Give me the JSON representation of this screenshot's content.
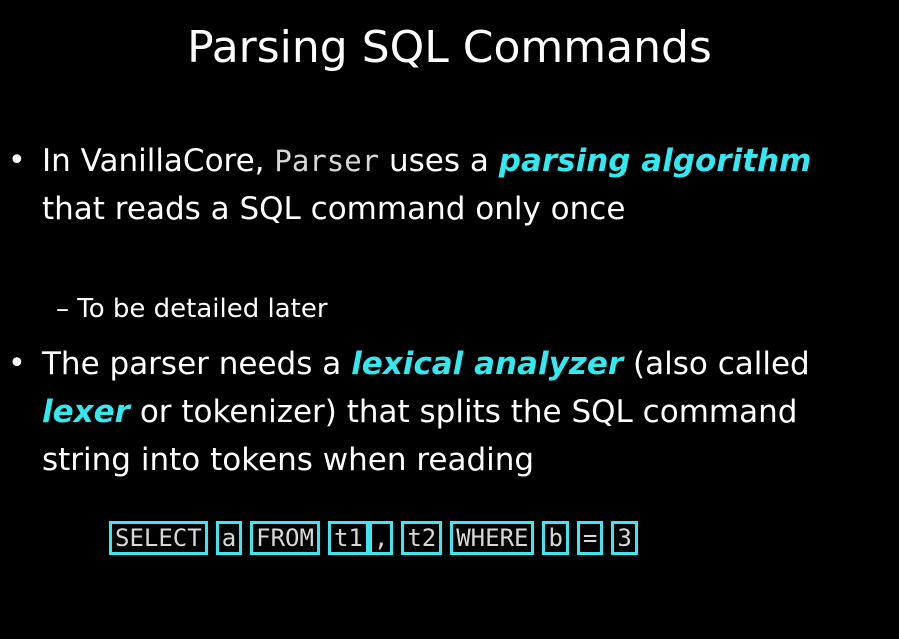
{
  "slide": {
    "title": "Parsing SQL Commands",
    "bullet_glyph": "•",
    "bullet1": {
      "t1": "In VanillaCore, ",
      "code": "Parser",
      "t2": " uses a ",
      "em1": "parsing algorithm",
      "t3": " that reads a SQL command only once"
    },
    "sub_bullet": "– To be detailed later",
    "bullet2": {
      "t1": "The parser needs a ",
      "em1": "lexical analyzer",
      "t2": " (also called ",
      "em2": "lexer",
      "t3": " or tokenizer) that splits the SQL command string into tokens when reading"
    },
    "tokens": [
      "SELECT",
      "a",
      "FROM",
      "t1",
      ",",
      "t2",
      "WHERE",
      "b",
      "=",
      "3"
    ]
  },
  "colors": {
    "background": "#000000",
    "text": "#ffffff",
    "emphasis": "#33e8ef",
    "token_border": "#3ee6ef",
    "code_text": "#d8d8d8"
  }
}
